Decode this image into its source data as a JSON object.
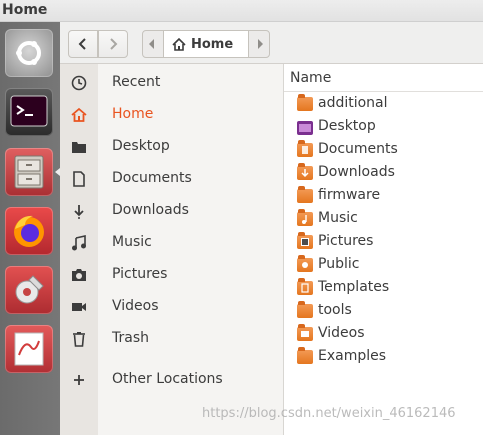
{
  "window": {
    "title": "Home"
  },
  "launcher": {
    "items": [
      {
        "name": "ubuntu-dash-icon",
        "color": "#b8b8b8"
      },
      {
        "name": "terminal-icon",
        "color": "#3a3a3a"
      },
      {
        "name": "file-cabinet-icon",
        "color": "#c84b4b"
      },
      {
        "name": "firefox-icon",
        "color": "#ff7a1c"
      },
      {
        "name": "settings-tools-icon",
        "color": "#c9474c"
      },
      {
        "name": "document-viewer-icon",
        "color": "#d04a4a"
      }
    ]
  },
  "nav": {
    "back_icon": "chevron-left-icon",
    "forward_icon": "chevron-right-icon"
  },
  "path": {
    "current": "Home"
  },
  "sidebar": {
    "items": [
      {
        "label": "Recent",
        "icon": "clock-icon"
      },
      {
        "label": "Home",
        "icon": "home-icon",
        "active": true
      },
      {
        "label": "Desktop",
        "icon": "folder-icon"
      },
      {
        "label": "Documents",
        "icon": "document-icon"
      },
      {
        "label": "Downloads",
        "icon": "download-icon"
      },
      {
        "label": "Music",
        "icon": "music-icon"
      },
      {
        "label": "Pictures",
        "icon": "camera-icon"
      },
      {
        "label": "Videos",
        "icon": "video-icon"
      },
      {
        "label": "Trash",
        "icon": "trash-icon"
      },
      {
        "label": "Other Locations",
        "icon": "plus-icon"
      }
    ]
  },
  "files": {
    "column_header": "Name",
    "items": [
      {
        "name": "additional"
      },
      {
        "name": "Desktop"
      },
      {
        "name": "Documents"
      },
      {
        "name": "Downloads"
      },
      {
        "name": "firmware"
      },
      {
        "name": "Music"
      },
      {
        "name": "Pictures"
      },
      {
        "name": "Public"
      },
      {
        "name": "Templates"
      },
      {
        "name": "tools"
      },
      {
        "name": "Videos"
      },
      {
        "name": "Examples"
      }
    ]
  },
  "watermark": "https://blog.csdn.net/weixin_46162146",
  "colors": {
    "accent": "#e95420",
    "folder": "#ee8a3c"
  }
}
